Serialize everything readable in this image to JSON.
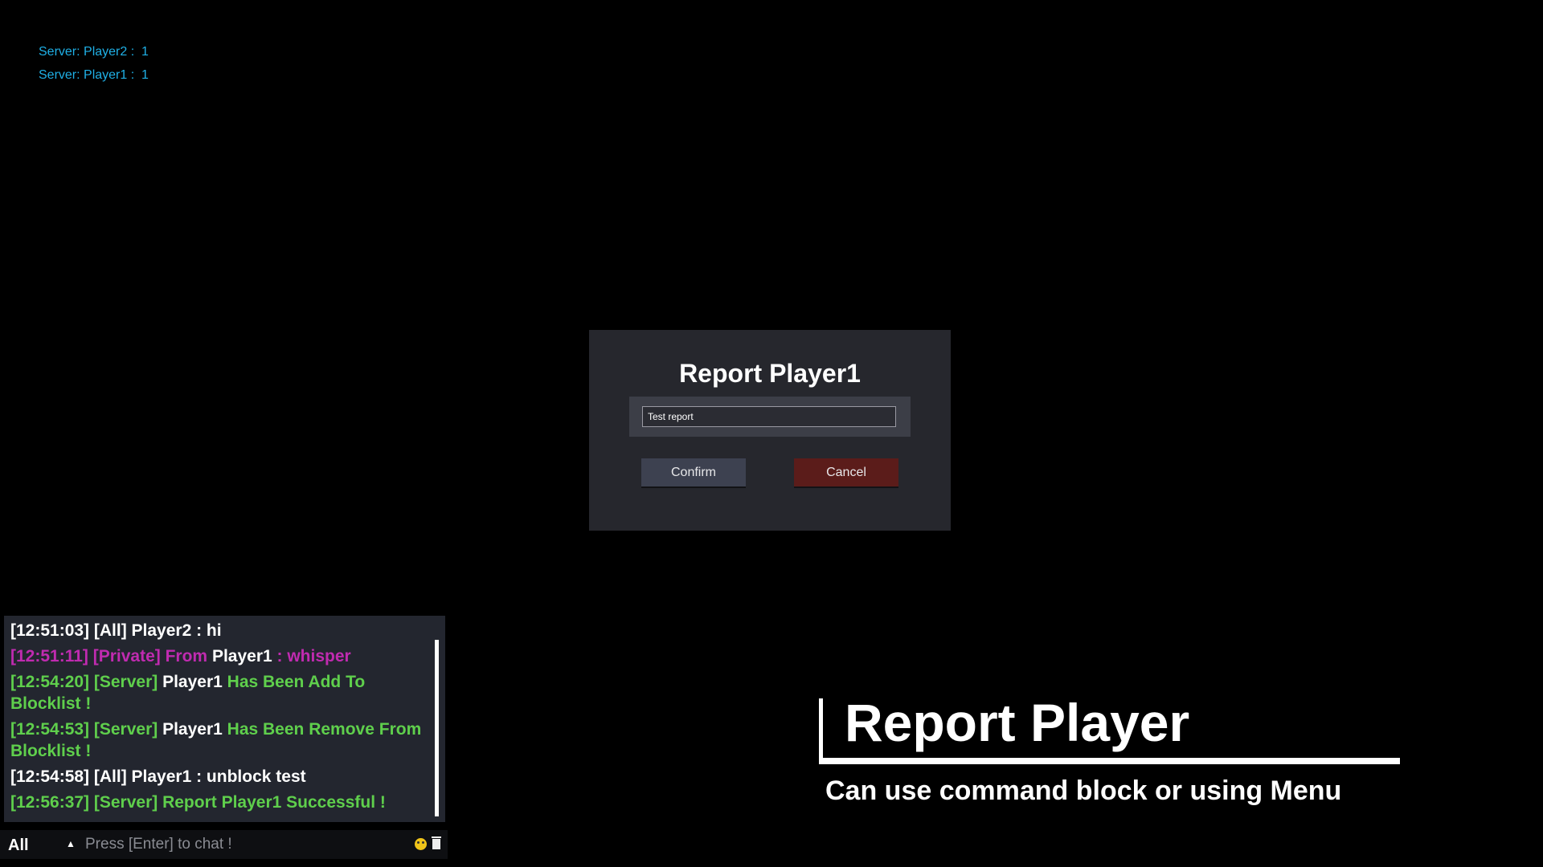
{
  "server_list": [
    {
      "text": "Server: Player2 :  1"
    },
    {
      "text": "Server: Player1 :  1"
    }
  ],
  "dialog": {
    "title": "Report Player1",
    "input_value": "Test report",
    "confirm_label": "Confirm",
    "cancel_label": "Cancel"
  },
  "chat": {
    "messages": [
      {
        "parts": [
          {
            "text": "[12:51:03] [All] Player2 : hi",
            "color": "#ffffff"
          }
        ]
      },
      {
        "parts": [
          {
            "text": "[12:51:11] [Private] From ",
            "color": "#c02bb0"
          },
          {
            "text": "Player1",
            "color": "#ffffff"
          },
          {
            "text": " : whisper",
            "color": "#c02bb0"
          }
        ]
      },
      {
        "parts": [
          {
            "text": "[12:54:20] [Server] ",
            "color": "#5fcf4c"
          },
          {
            "text": "Player1",
            "color": "#ffffff"
          },
          {
            "text": "  Has Been Add To Blocklist !",
            "color": "#5fcf4c"
          }
        ]
      },
      {
        "parts": [
          {
            "text": "[12:54:53] [Server] ",
            "color": "#5fcf4c"
          },
          {
            "text": "Player1",
            "color": "#ffffff"
          },
          {
            "text": "  Has Been Remove From Blocklist !",
            "color": "#5fcf4c"
          }
        ]
      },
      {
        "parts": [
          {
            "text": "[12:54:58] [All] Player1 : unblock test",
            "color": "#ffffff"
          }
        ]
      },
      {
        "parts": [
          {
            "text": "[12:56:37] [Server]  Report Player1 Successful !",
            "color": "#5fcf4c"
          }
        ]
      }
    ],
    "channel": "All",
    "placeholder": "Press [Enter] to chat !"
  },
  "overlay": {
    "title": "Report Player",
    "subtitle": "Can use command block or using Menu"
  },
  "colors": {
    "server_text": "#1fb0e6",
    "cancel_button": "#5b1c1a",
    "confirm_button": "#3d4150"
  }
}
